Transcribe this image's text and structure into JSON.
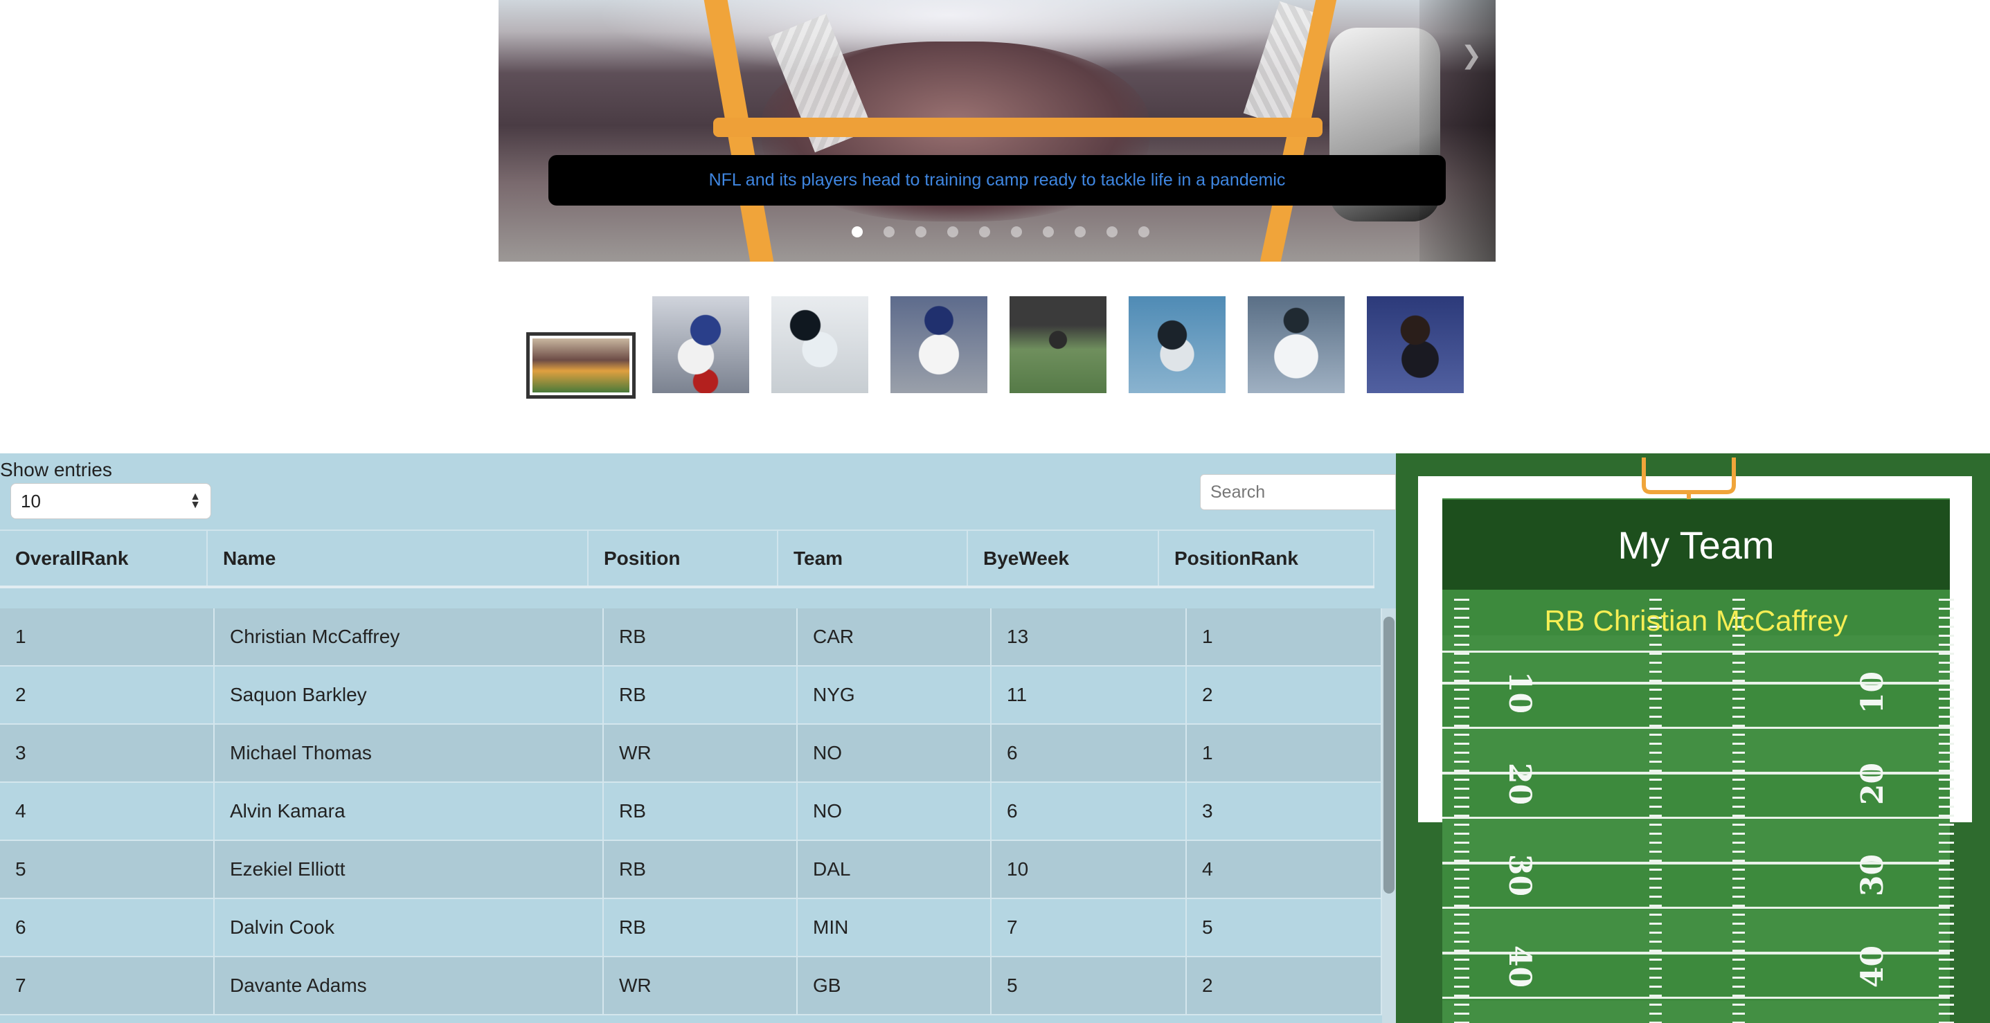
{
  "carousel": {
    "caption": "NFL and its players head to training camp ready to tackle life in a pandemic",
    "slide_count": 10,
    "active_slide": 1,
    "next_icon": "chevron-right-icon"
  },
  "thumbnails": [
    {
      "name": "helmet",
      "active": true
    },
    {
      "name": "giants-runner-1",
      "active": false
    },
    {
      "name": "panthers-runner-1",
      "active": false
    },
    {
      "name": "giants-runner-2",
      "active": false
    },
    {
      "name": "runner-field",
      "active": false
    },
    {
      "name": "panthers-runner-2",
      "active": false
    },
    {
      "name": "panthers-runner-3",
      "active": false
    },
    {
      "name": "receiver-catch",
      "active": false
    }
  ],
  "table": {
    "show_entries_label": "Show entries",
    "entries_value": "10",
    "search_placeholder": "Search",
    "columns": [
      "OverallRank",
      "Name",
      "Position",
      "Team",
      "ByeWeek",
      "PositionRank"
    ],
    "rows": [
      [
        "1",
        "Christian McCaffrey",
        "RB",
        "CAR",
        "13",
        "1"
      ],
      [
        "2",
        "Saquon Barkley",
        "RB",
        "NYG",
        "11",
        "2"
      ],
      [
        "3",
        "Michael Thomas",
        "WR",
        "NO",
        "6",
        "1"
      ],
      [
        "4",
        "Alvin Kamara",
        "RB",
        "NO",
        "6",
        "3"
      ],
      [
        "5",
        "Ezekiel Elliott",
        "RB",
        "DAL",
        "10",
        "4"
      ],
      [
        "6",
        "Dalvin Cook",
        "RB",
        "MIN",
        "7",
        "5"
      ],
      [
        "7",
        "Davante Adams",
        "WR",
        "GB",
        "5",
        "2"
      ]
    ]
  },
  "my_team": {
    "title": "My Team",
    "roster": [
      "RB Christian McCaffrey"
    ],
    "yard_numbers": [
      "10",
      "20",
      "30",
      "40"
    ]
  },
  "colors": {
    "caption_text": "#3f86e0",
    "table_bg": "#b5d6e2",
    "field_green": "#3d8a3d",
    "roster_text": "#f6ee54"
  }
}
